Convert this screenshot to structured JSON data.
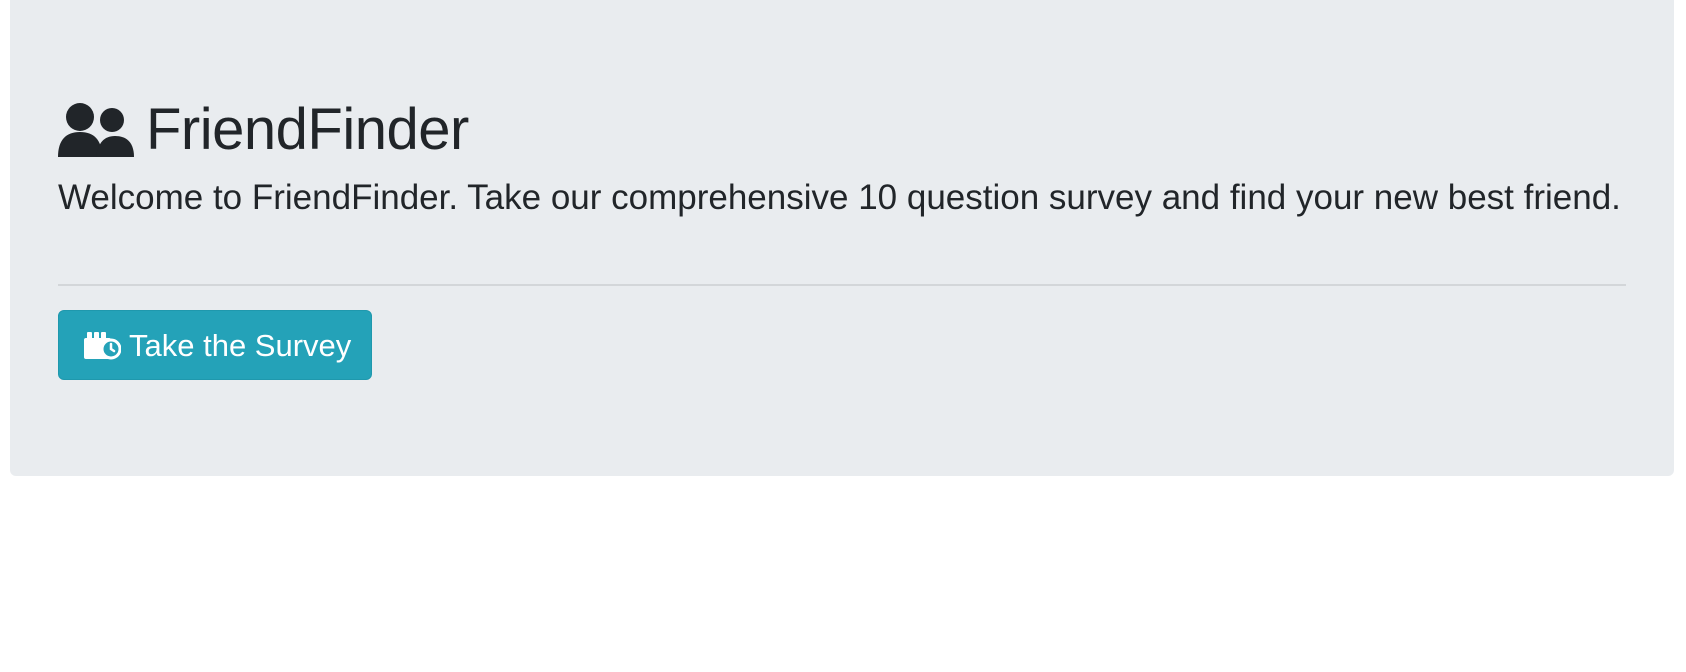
{
  "jumbotron": {
    "title": "FriendFinder",
    "title_icon": "users-icon",
    "lead": "Welcome to FriendFinder. Take our comprehensive 10 question survey and find your new best friend.",
    "button": {
      "label": "Take the Survey",
      "icon": "survey-icon"
    }
  },
  "colors": {
    "background": "#e9ecef",
    "text": "#212529",
    "button": "#24a2b8",
    "divider": "#d3d6d9"
  }
}
